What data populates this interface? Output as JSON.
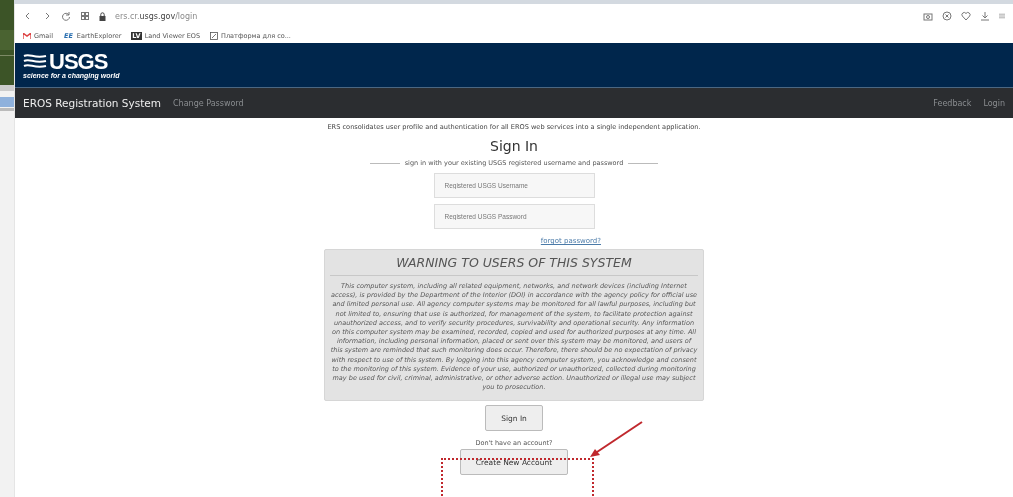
{
  "browser": {
    "url": "ers.cr.**usgs.gov**/login",
    "bookmarks": [
      {
        "kind": "gmail",
        "label": "Gmail"
      },
      {
        "kind": "ee",
        "label": "EarthExplorer",
        "badge": "EE"
      },
      {
        "kind": "lv",
        "label": "Land Viewer EOS",
        "badge": "LV"
      },
      {
        "kind": "edit",
        "label": "Платформа для со..."
      }
    ]
  },
  "header": {
    "logo": "USGS",
    "tagline": "science for a changing world"
  },
  "navbar": {
    "brand": "EROS Registration System",
    "left_links": [
      "Change Password"
    ],
    "right_links": [
      "Feedback",
      "Login"
    ]
  },
  "main": {
    "intro": "ERS consolidates user profile and authentication for all EROS web services into a single independent application.",
    "title": "Sign In",
    "subtitle": "sign in with your existing USGS registered username and password",
    "username": {
      "placeholder": "Registered USGS Username"
    },
    "password": {
      "placeholder": "Registered USGS Password"
    },
    "forgot_link": "forgot password?",
    "warning": {
      "title": "WARNING TO USERS OF THIS SYSTEM",
      "text": "This computer system, including all related equipment, networks, and network devices (including Internet access), is provided by the Department of the Interior (DOI) in accordance with the agency policy for official use and limited personal use. All agency computer systems may be monitored for all lawful purposes, including but not limited to, ensuring that use is authorized, for management of the system, to facilitate protection against unauthorized access, and to verify security procedures, survivability and operational security. Any information on this computer system may be examined, recorded, copied and used for authorized purposes at any time. All information, including personal information, placed or sent over this system may be monitored, and users of this system are reminded that such monitoring does occur. Therefore, there should be no expectation of privacy with respect to use of this system. By logging into this agency computer system, you acknowledge and consent to the monitoring of this system. Evidence of your use, authorized or unauthorized, collected during monitoring may be used for civil, criminal, administrative, or other adverse action. Unauthorized or illegal use may subject you to prosecution."
    },
    "sign_in_button": "Sign In",
    "no_account": "Don't have an account?",
    "create_button": "Create New Account"
  }
}
